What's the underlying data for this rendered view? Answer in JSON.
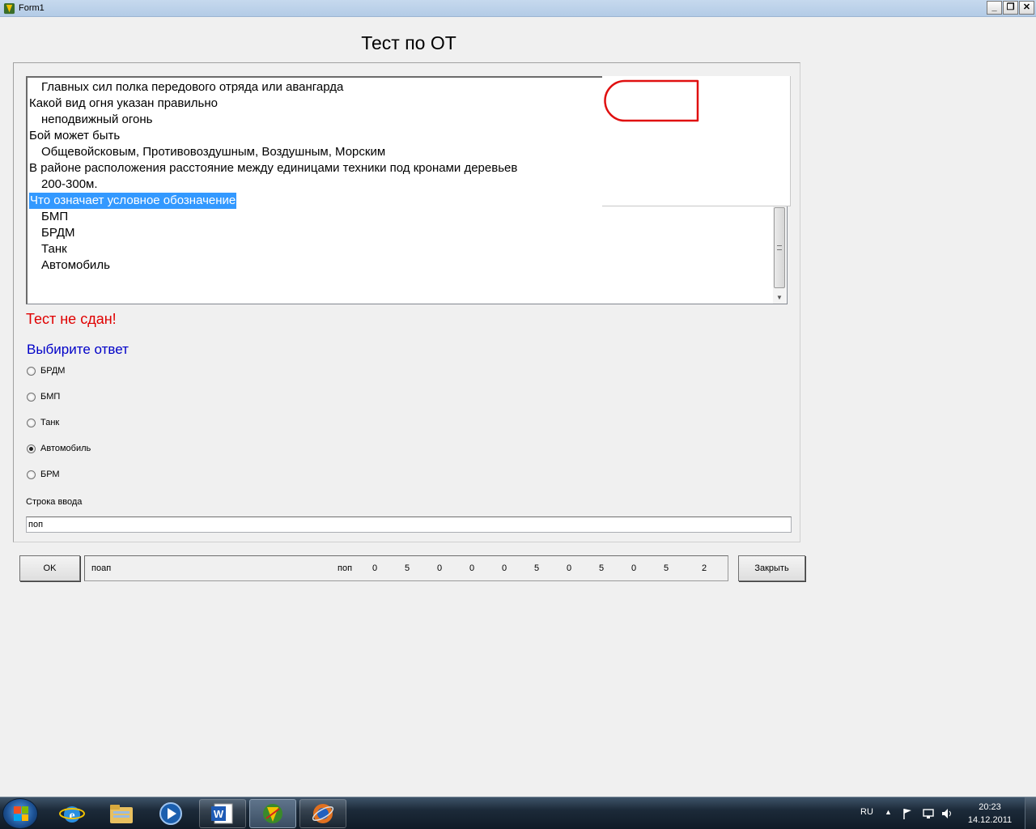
{
  "window": {
    "title": "Form1",
    "min_label": "_",
    "max_label": "❐",
    "close_label": "✕"
  },
  "heading": "Тест по ОТ",
  "memo_lines": [
    {
      "text": "Главных сил полка передового отряда или авангарда",
      "indent": true
    },
    {
      "text": "Какой вид огня указан правильно",
      "indent": false
    },
    {
      "text": "неподвижный огонь",
      "indent": true
    },
    {
      "text": "Бой может быть",
      "indent": false
    },
    {
      "text": "Общевойсковым, Противовоздушным, Воздушным, Морским",
      "indent": true
    },
    {
      "text": "В районе расположения расстояние между единицами техники под кронами деревьев",
      "indent": false
    },
    {
      "text": "200-300м.",
      "indent": true
    },
    {
      "text": "Что означает условное обозначение",
      "indent": false,
      "selected": true
    },
    {
      "text": "БМП",
      "indent": true
    },
    {
      "text": "БРДМ",
      "indent": true
    },
    {
      "text": "Танк",
      "indent": true
    },
    {
      "text": "Автомобиль",
      "indent": true
    }
  ],
  "result_text": "Тест не сдан!",
  "choose_text": "Выбирите ответ",
  "options": [
    {
      "label": "БРДМ",
      "checked": false
    },
    {
      "label": "БМП",
      "checked": false
    },
    {
      "label": "Танк",
      "checked": false
    },
    {
      "label": "Автомобиль",
      "checked": true
    },
    {
      "label": "БРМ",
      "checked": false
    }
  ],
  "input_label": "Строка ввода",
  "input_value": "поп",
  "ok_label": "OK",
  "close_label": "Закрыть",
  "status": {
    "left_text": "поап",
    "middle_text": "поп",
    "numbers": [
      "0",
      "5",
      "0",
      "0",
      "0",
      "5",
      "0",
      "5",
      "0",
      "5",
      "2"
    ]
  },
  "taskbar": {
    "apps": [
      "internet-explorer",
      "explorer",
      "media-player",
      "word",
      "test-app",
      "browser"
    ],
    "lang": "RU",
    "time": "20:23",
    "date": "14.12.2011"
  },
  "colors": {
    "result": "#e00000",
    "choose": "#0000c8",
    "selection": "#3399ff",
    "symbol": "#e01010"
  }
}
